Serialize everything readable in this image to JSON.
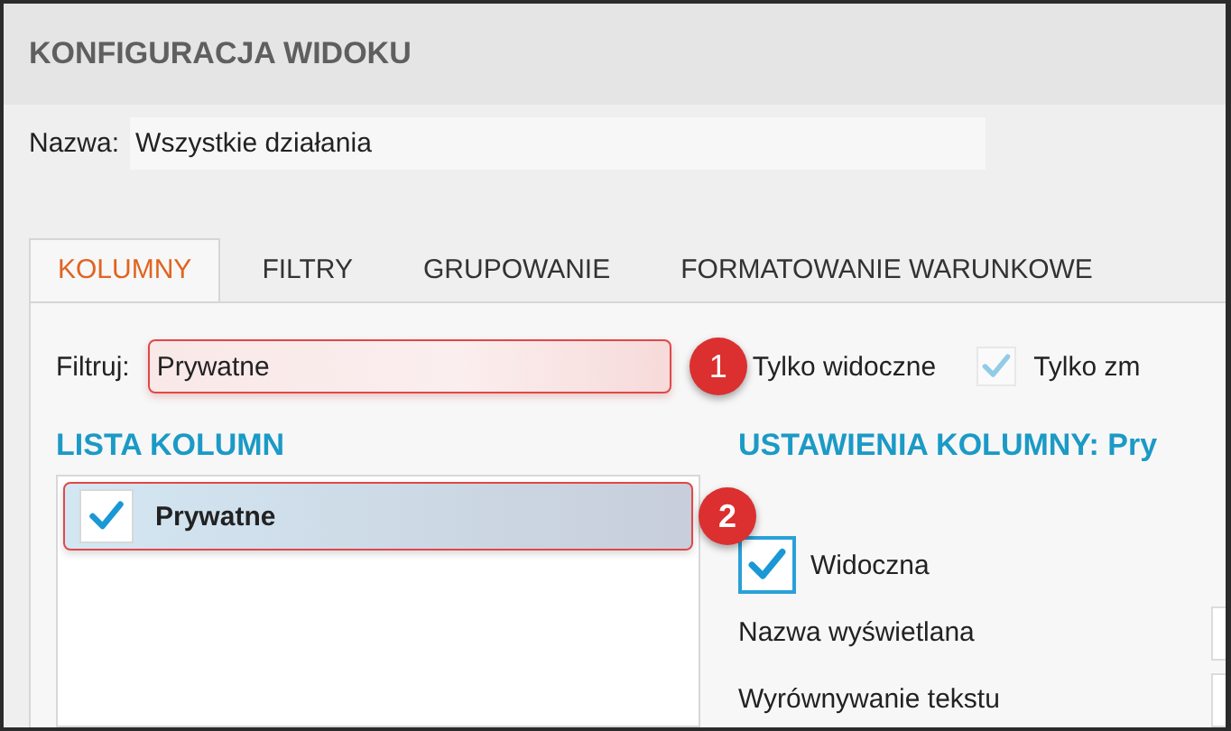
{
  "title": "KONFIGURACJA WIDOKU",
  "name_field": {
    "label": "Nazwa:",
    "value": "Wszystkie działania"
  },
  "tabs": [
    {
      "label": "KOLUMNY",
      "selected": true
    },
    {
      "label": "FILTRY",
      "selected": false
    },
    {
      "label": "GRUPOWANIE",
      "selected": false
    },
    {
      "label": "FORMATOWANIE WARUNKOWE",
      "selected": false
    }
  ],
  "filter": {
    "label": "Filtruj:",
    "value": "Prywatne",
    "callout": "1"
  },
  "options": [
    {
      "label": "Tylko widoczne"
    },
    {
      "label": "Tylko zm",
      "checked": true,
      "disabled": true
    }
  ],
  "column_list": {
    "heading": "LISTA KOLUMN",
    "items": [
      {
        "label": "Prywatne",
        "checked": true,
        "selected": true,
        "callout": "2"
      }
    ]
  },
  "column_settings": {
    "heading": "USTAWIENIA KOLUMNY: Pry",
    "visible": {
      "label": "Widoczna",
      "checked": true
    },
    "fields": [
      {
        "label": "Nazwa wyświetlana"
      },
      {
        "label": "Wyrównywanie tekstu"
      }
    ]
  }
}
